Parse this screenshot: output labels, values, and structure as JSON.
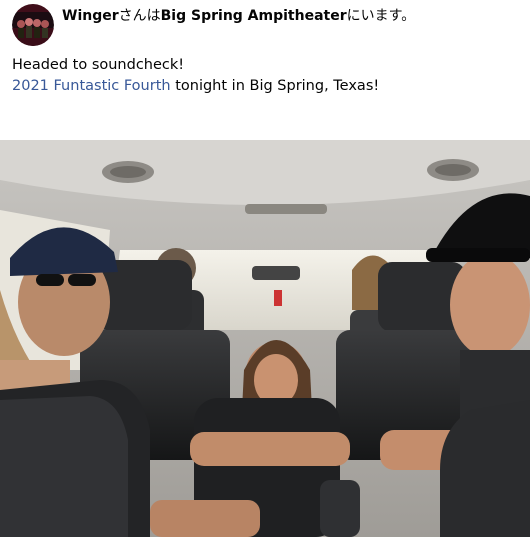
{
  "post": {
    "author_name": "Winger",
    "particle_1": "さんは",
    "place_name": "Big Spring Ampitheater",
    "particle_2": "にいます。",
    "line_1": "Headed to soundcheck!",
    "event_link": "2021 Funtastic Fourth",
    "line_2_rest": " tonight in Big Spring, Texas!"
  },
  "colors": {
    "link": "#385898",
    "text": "#050505"
  },
  "icons": {
    "avatar": "band-avatar-image",
    "photo": "band-in-car-photo"
  }
}
